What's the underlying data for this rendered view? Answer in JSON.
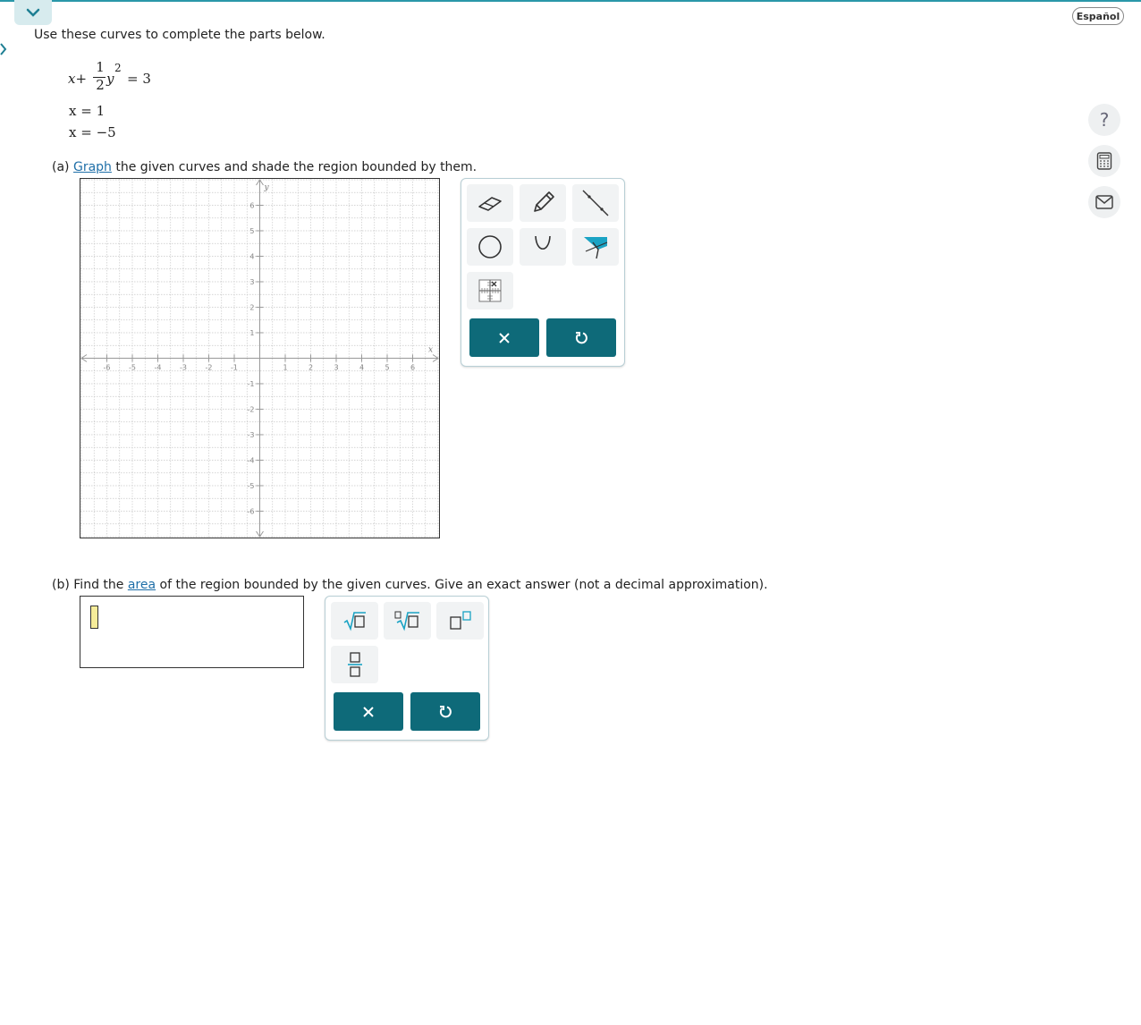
{
  "header": {
    "language_button": "Español",
    "help_symbol": "?",
    "icons": [
      "chevron-down-icon",
      "chevron-right-icon",
      "help-icon",
      "calculator-icon",
      "mail-icon"
    ]
  },
  "intro": "Use these curves to complete the parts below.",
  "equations": {
    "eq1": {
      "x": "x",
      "plus": "+",
      "num": "1",
      "den": "2",
      "y": "y",
      "exp": "2",
      "rhs": "= 3"
    },
    "eq2": "x = 1",
    "eq3": "x = −5"
  },
  "part_a": {
    "label": "(a)",
    "link": "Graph",
    "text": "the given curves and shade the region bounded by them."
  },
  "graph": {
    "x_axis_label": "x",
    "y_axis_label": "y",
    "x_ticks": [
      "-6",
      "-5",
      "-4",
      "-3",
      "-2",
      "-1",
      "1",
      "2",
      "3",
      "4",
      "5",
      "6"
    ],
    "y_ticks": [
      "6",
      "5",
      "4",
      "3",
      "2",
      "1",
      "-1",
      "-2",
      "-3",
      "-4",
      "-5",
      "-6"
    ],
    "grid": true
  },
  "graph_tools": [
    "eraser-icon",
    "pencil-icon",
    "line-segment-icon",
    "circle-icon",
    "parabola-icon",
    "shade-region-icon",
    "no-solution-icon"
  ],
  "part_b": {
    "label": "(b)",
    "pre": "Find the",
    "link": "area",
    "post": "of the region bounded by the given curves. Give an exact answer (not a decimal approximation)."
  },
  "math_tools": [
    "square-root-icon",
    "nth-root-icon",
    "exponent-icon",
    "fraction-icon"
  ],
  "colors": {
    "accent": "#0e6a79",
    "link": "#1f6fa8",
    "shade": "#1aa3c4"
  }
}
